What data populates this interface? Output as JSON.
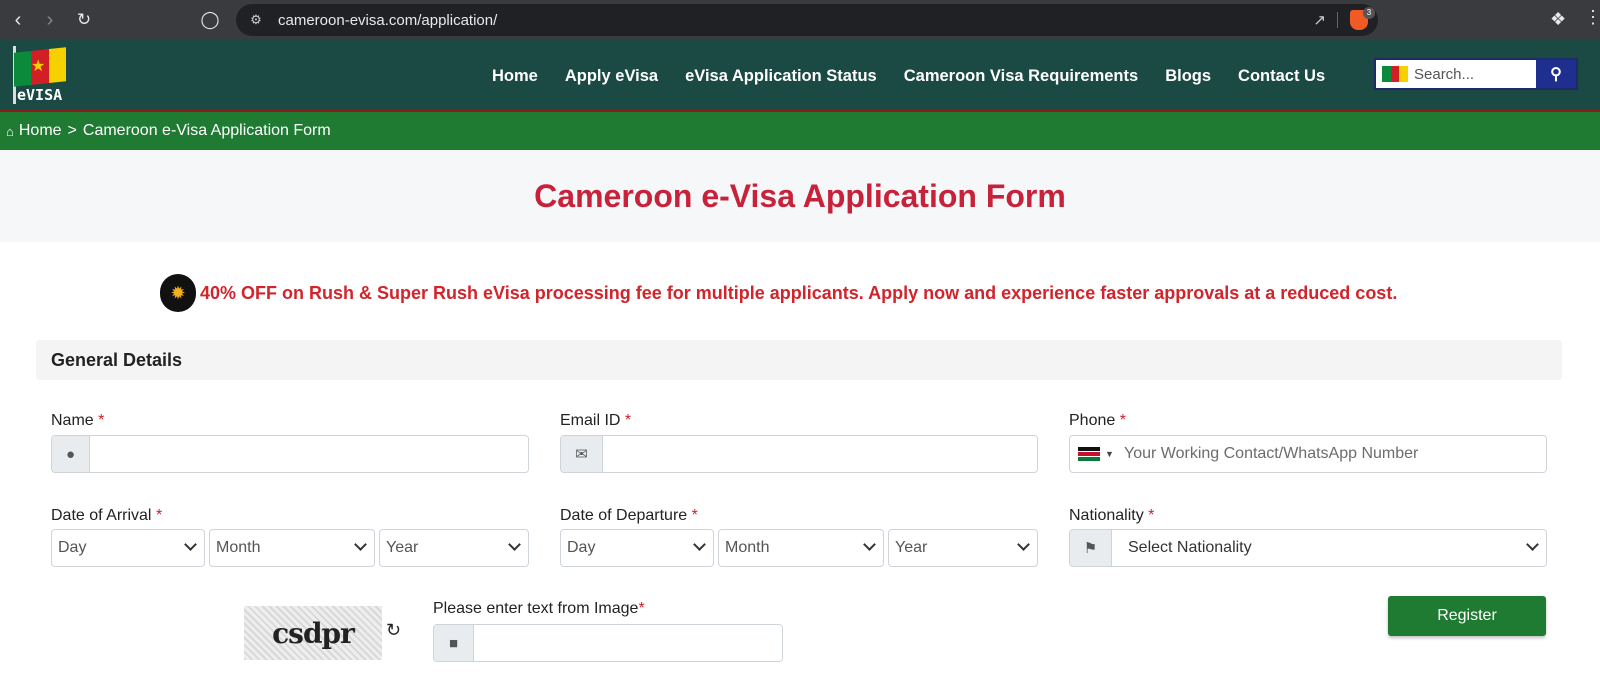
{
  "browser": {
    "url": "cameroon-evisa.com/application/",
    "extension_badge": "3"
  },
  "header": {
    "logo_text": "eVISA",
    "nav": [
      "Home",
      "Apply eVisa",
      "eVisa Application Status",
      "Cameroon Visa Requirements",
      "Blogs",
      "Contact Us"
    ],
    "search_placeholder": "Search..."
  },
  "breadcrumb": {
    "home": "Home",
    "separator": ">",
    "current": "Cameroon e-Visa Application Form"
  },
  "page_title": "Cameroon e-Visa Application Form",
  "promo_text": "40% OFF on Rush & Super Rush eVisa processing fee for multiple applicants. Apply now and experience faster approvals at a reduced cost.",
  "form": {
    "section_title": "General Details",
    "required_marker": "*",
    "name_label": "Name",
    "email_label": "Email ID",
    "phone_label": "Phone",
    "phone_placeholder": "Your Working Contact/WhatsApp Number",
    "arrival_label": "Date of Arrival",
    "departure_label": "Date of Departure",
    "nationality_label": "Nationality",
    "nationality_placeholder": "Select Nationality",
    "day": "Day",
    "month": "Month",
    "year": "Year",
    "captcha_text": "csdpr",
    "captcha_label": "Please enter text from Image",
    "register_label": "Register"
  },
  "colors": {
    "header_bg": "#1b4a44",
    "breadcrumb_bg": "#1f7a32",
    "title_red": "#c8213a",
    "promo_red": "#d1242b",
    "button_green": "#1f7a32"
  }
}
